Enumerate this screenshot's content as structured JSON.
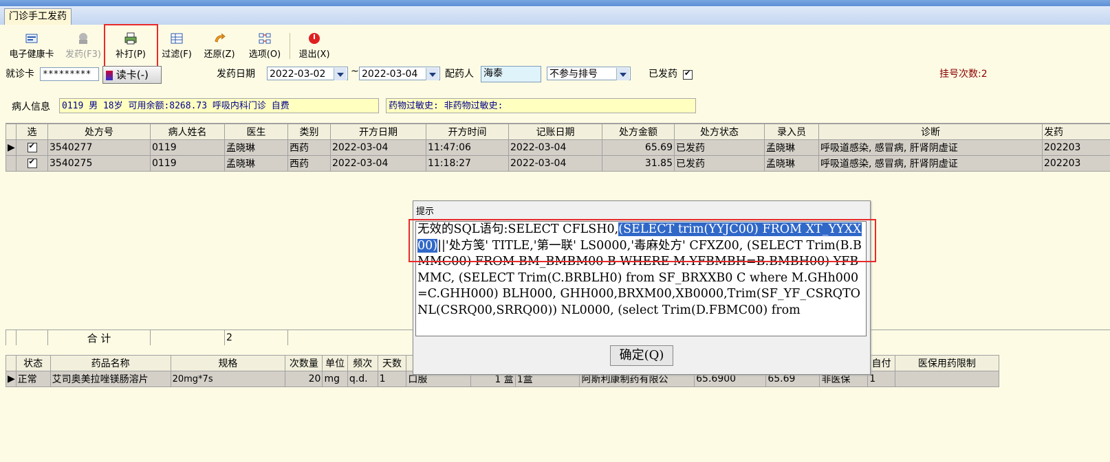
{
  "tab": {
    "label": "门诊手工发药"
  },
  "toolbar": {
    "health_card": "电子健康卡",
    "dispense": "发药(F3)",
    "reprint": "补打(P)",
    "filter": "过滤(F)",
    "restore": "还原(Z)",
    "options": "选项(O)",
    "exit": "退出(X)"
  },
  "filters": {
    "card_label": "就诊卡",
    "card_value": "*********",
    "read_card": "读卡(-)",
    "date_label": "发药日期",
    "date_from": "2022-03-02",
    "date_sep": "~",
    "date_to": "2022-03-04",
    "pharmacist_label": "配药人",
    "pharmacist_value": "海泰",
    "queue_option": "不参与排号",
    "dispensed_label": "已发药",
    "reg_count": "挂号次数:2"
  },
  "patient": {
    "label": "病人信息",
    "info": "0119  男 18岁 可用余额:8268.73 呼吸内科门诊 自费",
    "allergy": "药物过敏史:       非药物过敏史:"
  },
  "rx_table": {
    "headers": [
      "选",
      "处方号",
      "病人姓名",
      "医生",
      "类别",
      "开方日期",
      "开方时间",
      "记账日期",
      "处方金额",
      "处方状态",
      "录入员",
      "诊断",
      "发药"
    ],
    "rows": [
      [
        "",
        "3540277",
        "0119",
        "孟晓琳",
        "西药",
        "2022-03-04",
        "11:47:06",
        "2022-03-04",
        "65.69",
        "已发药",
        "孟晓琳",
        "呼吸道感染, 感冒病, 肝肾阴虚证",
        "202203"
      ],
      [
        "",
        "3540275",
        "0119",
        "孟晓琳",
        "西药",
        "2022-03-04",
        "11:18:27",
        "2022-03-04",
        "31.85",
        "已发药",
        "孟晓琳",
        "呼吸道感染, 感冒病, 肝肾阴虚证",
        "202203"
      ]
    ],
    "total_label": "合  计",
    "total_count": "2"
  },
  "drug_table": {
    "headers": [
      "状态",
      "药品名称",
      "规格",
      "次数量",
      "单位",
      "频次",
      "天数",
      "",
      "",
      "",
      "",
      "",
      "",
      "",
      "自付",
      "医保用药限制"
    ],
    "row": {
      "status": "正常",
      "name": "艾司奥美拉唑镁肠溶片",
      "spec": "20mg*7s",
      "dose": "20",
      "unit": "mg",
      "freq": "q.d.",
      "days": "1",
      "route": "口服",
      "qty": "1 盒",
      "pack": "1盒",
      "maker": "阿斯利康制药有限公",
      "price": "65.6900",
      "amount": "65.69",
      "ins": "非医保",
      "self": "1"
    }
  },
  "dialog": {
    "title": "提示",
    "msg_pre": "无效的SQL语句:SELECT CFLSH0,",
    "msg_hl": "(SELECT trim(YYJC00) FROM XT_YYXX00)",
    "msg_post": "||'处方笺' TITLE,'第一联' LS0000,'毒麻处方' CFXZ00, (SELECT Trim(B.BMMC00) FROM BM_BMBM00 B WHERE M.YFBMBH=B.BMBH00) YFBMMC, (SELECT Trim(C.BRBLH0) from SF_BRXXB0 C where M.GHh000=C.GHH000) BLH000, GHH000,BRXM00,XB0000,Trim(SF_YF_CSRQTONL(CSRQ00,SRRQ00)) NL0000, (select Trim(D.FBMC00) from",
    "ok": "确定(Q)"
  }
}
